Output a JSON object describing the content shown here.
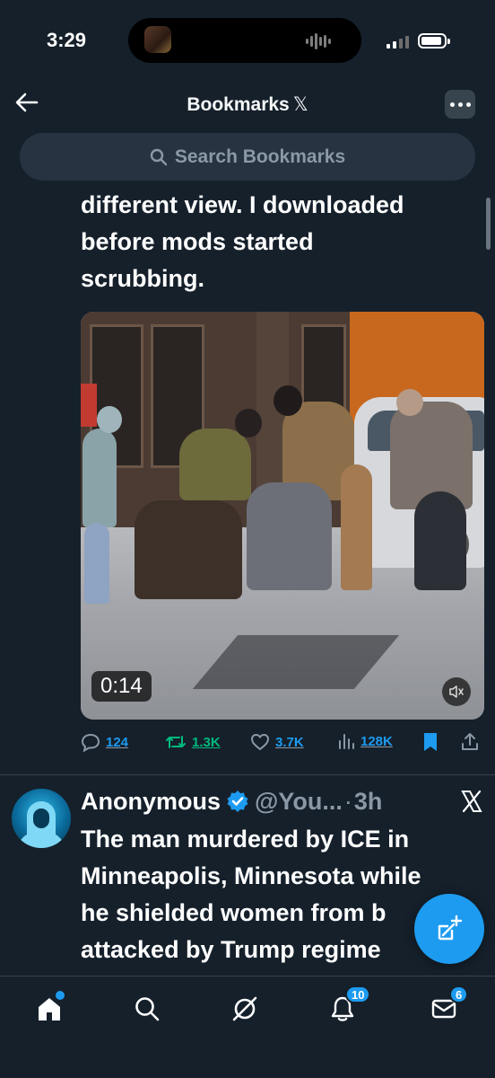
{
  "status_bar": {
    "time": "3:29"
  },
  "header": {
    "title": "Bookmarks",
    "title_logo": "𝕏",
    "back_icon": "arrow-left-icon",
    "more_icon": "more-horizontal-icon"
  },
  "search": {
    "placeholder": "Search Bookmarks",
    "icon": "search-icon"
  },
  "tweets": [
    {
      "text_lines": [
        "different view. I downloaded",
        "before mods started",
        "scrubbing."
      ],
      "media": {
        "type": "video",
        "duration": "0:14",
        "muted": true
      },
      "stats": {
        "replies": "124",
        "reposts": "1.3K",
        "likes": "3.7K",
        "views": "128K",
        "bookmarked": true
      }
    },
    {
      "author_name": "Anonymous",
      "verified": true,
      "handle": "@You...",
      "separator": "·",
      "time": "3h",
      "text_lines": [
        "The man murdered by ICE in",
        "Minneapolis, Minnesota while",
        "he shielded women from b",
        "attacked by Trump regime",
        "  "
      ]
    }
  ],
  "tab_bar": {
    "items": [
      {
        "name": "home",
        "icon": "home-icon",
        "has_dot": true
      },
      {
        "name": "search",
        "icon": "search-icon"
      },
      {
        "name": "grok",
        "icon": "grok-icon"
      },
      {
        "name": "notifications",
        "icon": "bell-icon",
        "badge": "10"
      },
      {
        "name": "messages",
        "icon": "mail-icon",
        "badge": "6"
      }
    ]
  },
  "colors": {
    "background": "#15202b",
    "accent": "#1d9bf0",
    "repost_green": "#00ba7c",
    "secondary_text": "#8b98a5"
  }
}
